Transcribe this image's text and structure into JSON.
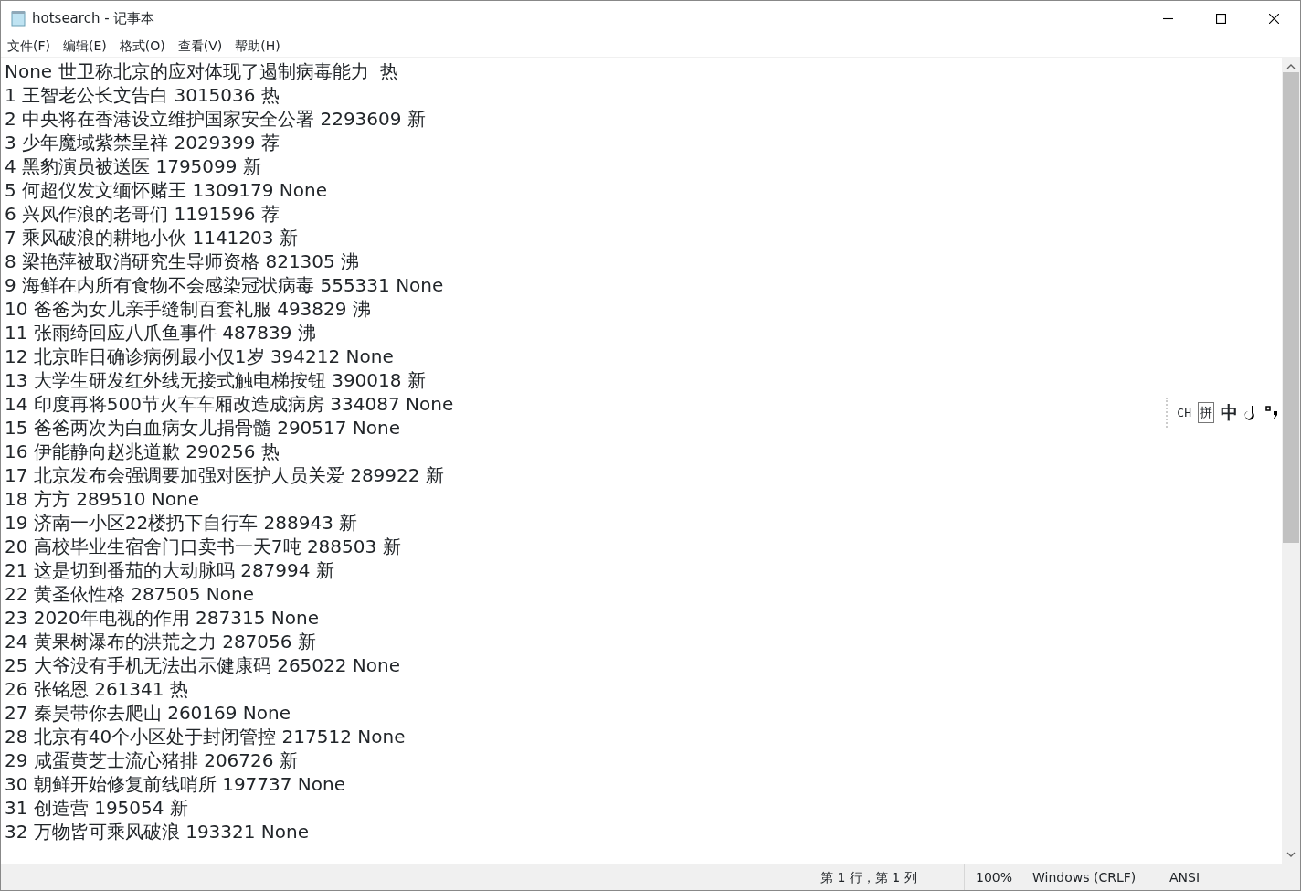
{
  "window": {
    "title": "hotsearch - 记事本"
  },
  "menu": [
    "文件(F)",
    "编辑(E)",
    "格式(O)",
    "查看(V)",
    "帮助(H)"
  ],
  "lines": [
    "None 世卫称北京的应对体现了遏制病毒能力  热",
    "1 王智老公长文告白 3015036 热",
    "2 中央将在香港设立维护国家安全公署 2293609 新",
    "3 少年魔域紫禁呈祥 2029399 荐",
    "4 黑豹演员被送医 1795099 新",
    "5 何超仪发文缅怀赌王 1309179 None",
    "6 兴风作浪的老哥们 1191596 荐",
    "7 乘风破浪的耕地小伙 1141203 新",
    "8 梁艳萍被取消研究生导师资格 821305 沸",
    "9 海鲜在内所有食物不会感染冠状病毒 555331 None",
    "10 爸爸为女儿亲手缝制百套礼服 493829 沸",
    "11 张雨绮回应八爪鱼事件 487839 沸",
    "12 北京昨日确诊病例最小仅1岁 394212 None",
    "13 大学生研发红外线无接式触电梯按钮 390018 新",
    "14 印度再将500节火车车厢改造成病房 334087 None",
    "15 爸爸两次为白血病女儿捐骨髓 290517 None",
    "16 伊能静向赵兆道歉 290256 热",
    "17 北京发布会强调要加强对医护人员关爱 289922 新",
    "18 方方 289510 None",
    "19 济南一小区22楼扔下自行车 288943 新",
    "20 高校毕业生宿舍门口卖书一天7吨 288503 新",
    "21 这是切到番茄的大动脉吗 287994 新",
    "22 黄圣依性格 287505 None",
    "23 2020年电视的作用 287315 None",
    "24 黄果树瀑布的洪荒之力 287056 新",
    "25 大爷没有手机无法出示健康码 265022 None",
    "26 张铭恩 261341 热",
    "27 秦昊带你去爬山 260169 None",
    "28 北京有40个小区处于封闭管控 217512 None",
    "29 咸蛋黄芝士流心猪排 206726 新",
    "30 朝鲜开始修复前线哨所 197737 None",
    "31 创造营 195054 新",
    "32 万物皆可乘风破浪 193321 None"
  ],
  "ime_toolbar": [
    "CH",
    "拼",
    "中"
  ],
  "status_bar": [
    "第 1 行，第 1 列",
    "100%",
    "Windows (CRLF)",
    "ANSI"
  ]
}
